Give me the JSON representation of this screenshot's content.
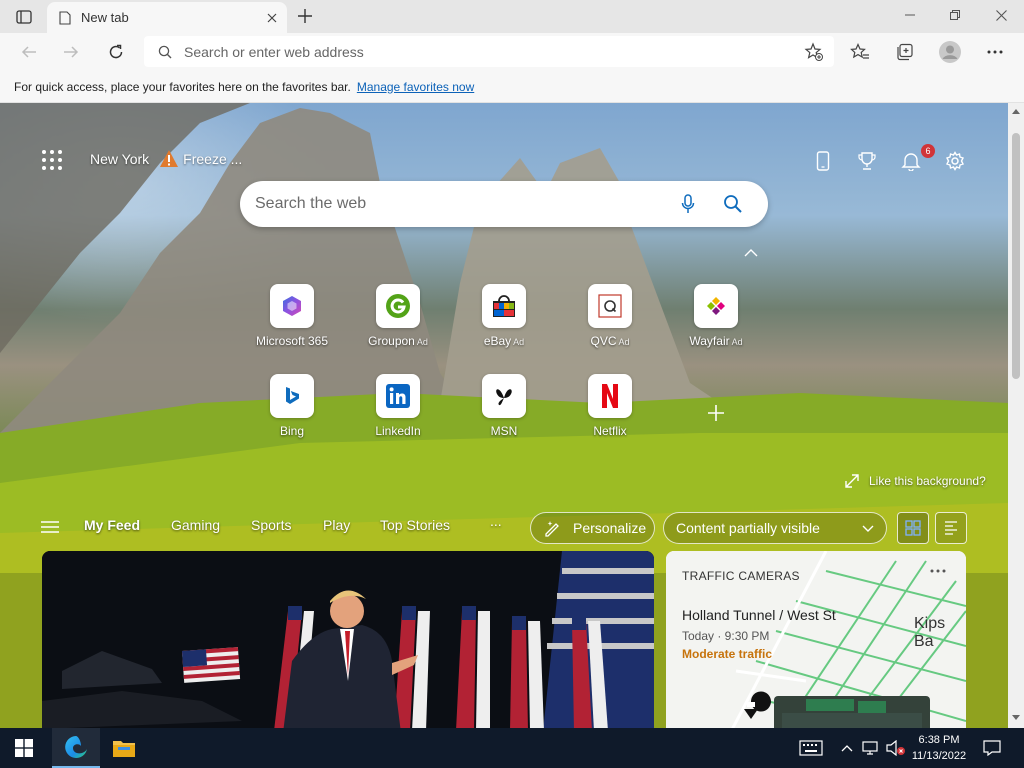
{
  "browser": {
    "tab": {
      "title": "New tab"
    },
    "address_bar": {
      "placeholder": "Search or enter web address"
    }
  },
  "favorites_bar": {
    "message": "For quick access, place your favorites here on the favorites bar.",
    "link": "Manage favorites now"
  },
  "newtab": {
    "weather": {
      "city": "New York",
      "condition": "Freeze ..."
    },
    "notifications_count": "6",
    "search": {
      "placeholder": "Search the web"
    },
    "quick_links": [
      {
        "label": "Microsoft 365",
        "ad": ""
      },
      {
        "label": "Groupon",
        "ad": "Ad"
      },
      {
        "label": "eBay",
        "ad": "Ad"
      },
      {
        "label": "QVC",
        "ad": "Ad"
      },
      {
        "label": "Wayfair",
        "ad": "Ad"
      },
      {
        "label": "Bing",
        "ad": ""
      },
      {
        "label": "LinkedIn",
        "ad": ""
      },
      {
        "label": "MSN",
        "ad": ""
      },
      {
        "label": "Netflix",
        "ad": ""
      }
    ],
    "like_background": "Like this background?",
    "feed_nav": {
      "items": [
        "My Feed",
        "Gaming",
        "Sports",
        "Play",
        "Top Stories"
      ],
      "more": "...",
      "personalize": "Personalize",
      "content_visibility": "Content partially visible"
    },
    "traffic_card": {
      "title": "TRAFFIC CAMERAS",
      "location": "Holland Tunnel / West St",
      "time": "Today · 9:30 PM",
      "status": "Moderate traffic",
      "map_label": "Kips Ba"
    }
  },
  "taskbar": {
    "time": "6:38 PM",
    "date": "11/13/2022"
  },
  "colors": {
    "accent": "#0c62b8",
    "traffic_status": "#c7730c",
    "badge": "#d13438",
    "taskbar": "#0f1a2a"
  }
}
